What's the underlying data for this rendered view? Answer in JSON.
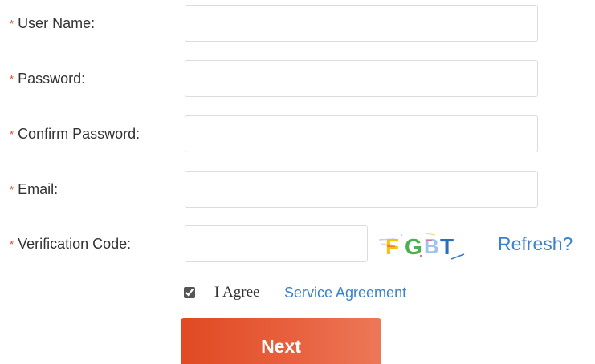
{
  "form": {
    "required_marker": "*",
    "fields": [
      {
        "label": "User Name:",
        "value": ""
      },
      {
        "label": "Password:",
        "value": ""
      },
      {
        "label": "Confirm Password:",
        "value": ""
      },
      {
        "label": "Email:",
        "value": ""
      },
      {
        "label": "Verification Code:",
        "value": ""
      }
    ],
    "captcha": {
      "text": "FGBT",
      "refresh_label": "Refresh?"
    },
    "agreement": {
      "checked": true,
      "agree_label": "I Agree",
      "link_label": "Service Agreement"
    },
    "next_label": "Next"
  },
  "colors": {
    "required_star": "#e0452a",
    "link": "#3b82c8",
    "button_gradient_start": "#e04a22",
    "button_gradient_end": "#ec7858",
    "input_border": "#dcdcdc"
  },
  "icons": {
    "checkbox": "checkbox-checked-icon"
  }
}
